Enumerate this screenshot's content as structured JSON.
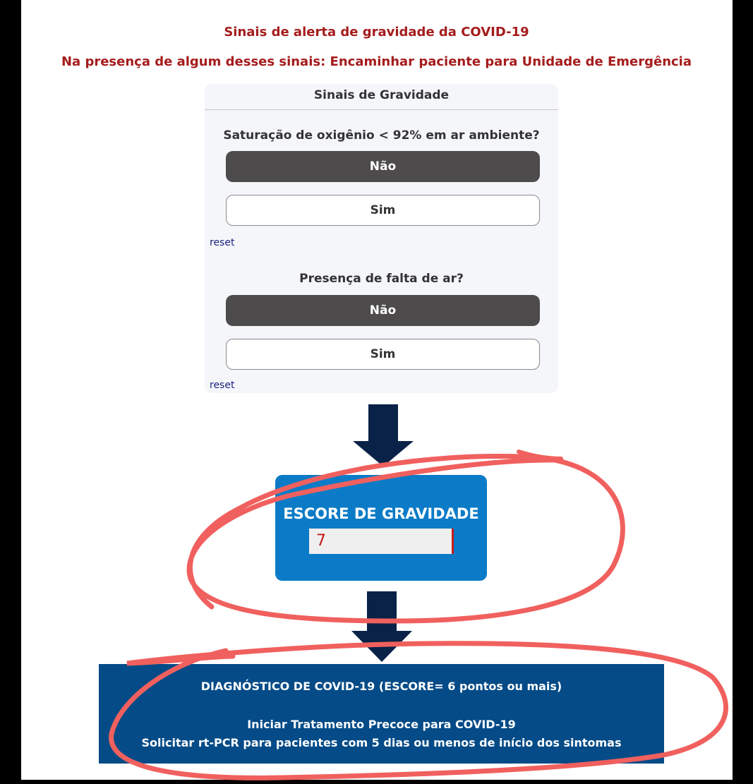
{
  "header": {
    "title": "Sinais de alerta de gravidade da COVID-19",
    "instruction": "Na presença de algum desses sinais: Encaminhar paciente para Unidade de Emergência"
  },
  "panel": {
    "title": "Sinais de Gravidade",
    "questions": [
      {
        "label": "Saturação de oxigênio < 92% em ar ambiente?",
        "option_no": "Não",
        "option_yes": "Sim",
        "selected": "Não",
        "reset_label": "reset"
      },
      {
        "label": "Presença de falta de ar?",
        "option_no": "Não",
        "option_yes": "Sim",
        "selected": "Não",
        "reset_label": "reset"
      }
    ]
  },
  "score": {
    "label": "ESCORE DE GRAVIDADE",
    "value": "7"
  },
  "diagnosis": {
    "title": "DIAGNÓSTICO DE COVID-19 (ESCORE= 6 pontos ou mais)",
    "line1": "Iniciar Tratamento Precoce para COVID-19",
    "line2": "Solicitar rt-PCR para pacientes com 5 dias ou menos de início dos sintomas"
  },
  "colors": {
    "alert_red": "#a51c1c",
    "selected_button": "#4d4b4b",
    "score_blue": "#0c7bc7",
    "diagnosis_blue": "#044b87",
    "arrow_navy": "#0a2248",
    "annotation_red": "#f0605e"
  }
}
